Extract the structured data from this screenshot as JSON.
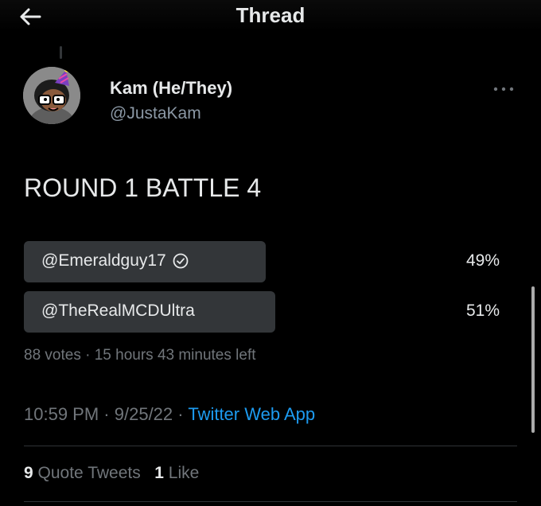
{
  "header": {
    "title": "Thread",
    "back_icon": "arrow-left-icon"
  },
  "tweet": {
    "author": {
      "display_name": "Kam (He/They)",
      "handle": "@JustaKam"
    },
    "text": "ROUND 1 BATTLE 4",
    "poll": {
      "options": [
        {
          "label": "@Emeraldguy17",
          "percent": "49%",
          "fraction": 0.49,
          "verified_icon": "circle-check-icon"
        },
        {
          "label": "@TheRealMCDUltra",
          "percent": "51%",
          "fraction": 0.51
        }
      ],
      "votes": "88 votes",
      "separator": "·",
      "time_left": "15 hours 43 minutes left"
    },
    "timestamp": {
      "time": "10:59 PM",
      "date": "9/25/22",
      "separator": "·",
      "source": "Twitter Web App"
    },
    "stats": {
      "quote_tweets_count": "9",
      "quote_tweets_label": "Quote Tweets",
      "likes_count": "1",
      "likes_label": "Like"
    }
  },
  "colors": {
    "background": "#000000",
    "text_primary": "#e7e9ea",
    "text_secondary": "#71767b",
    "accent": "#1d9bf0",
    "poll_bar": "#333639"
  }
}
